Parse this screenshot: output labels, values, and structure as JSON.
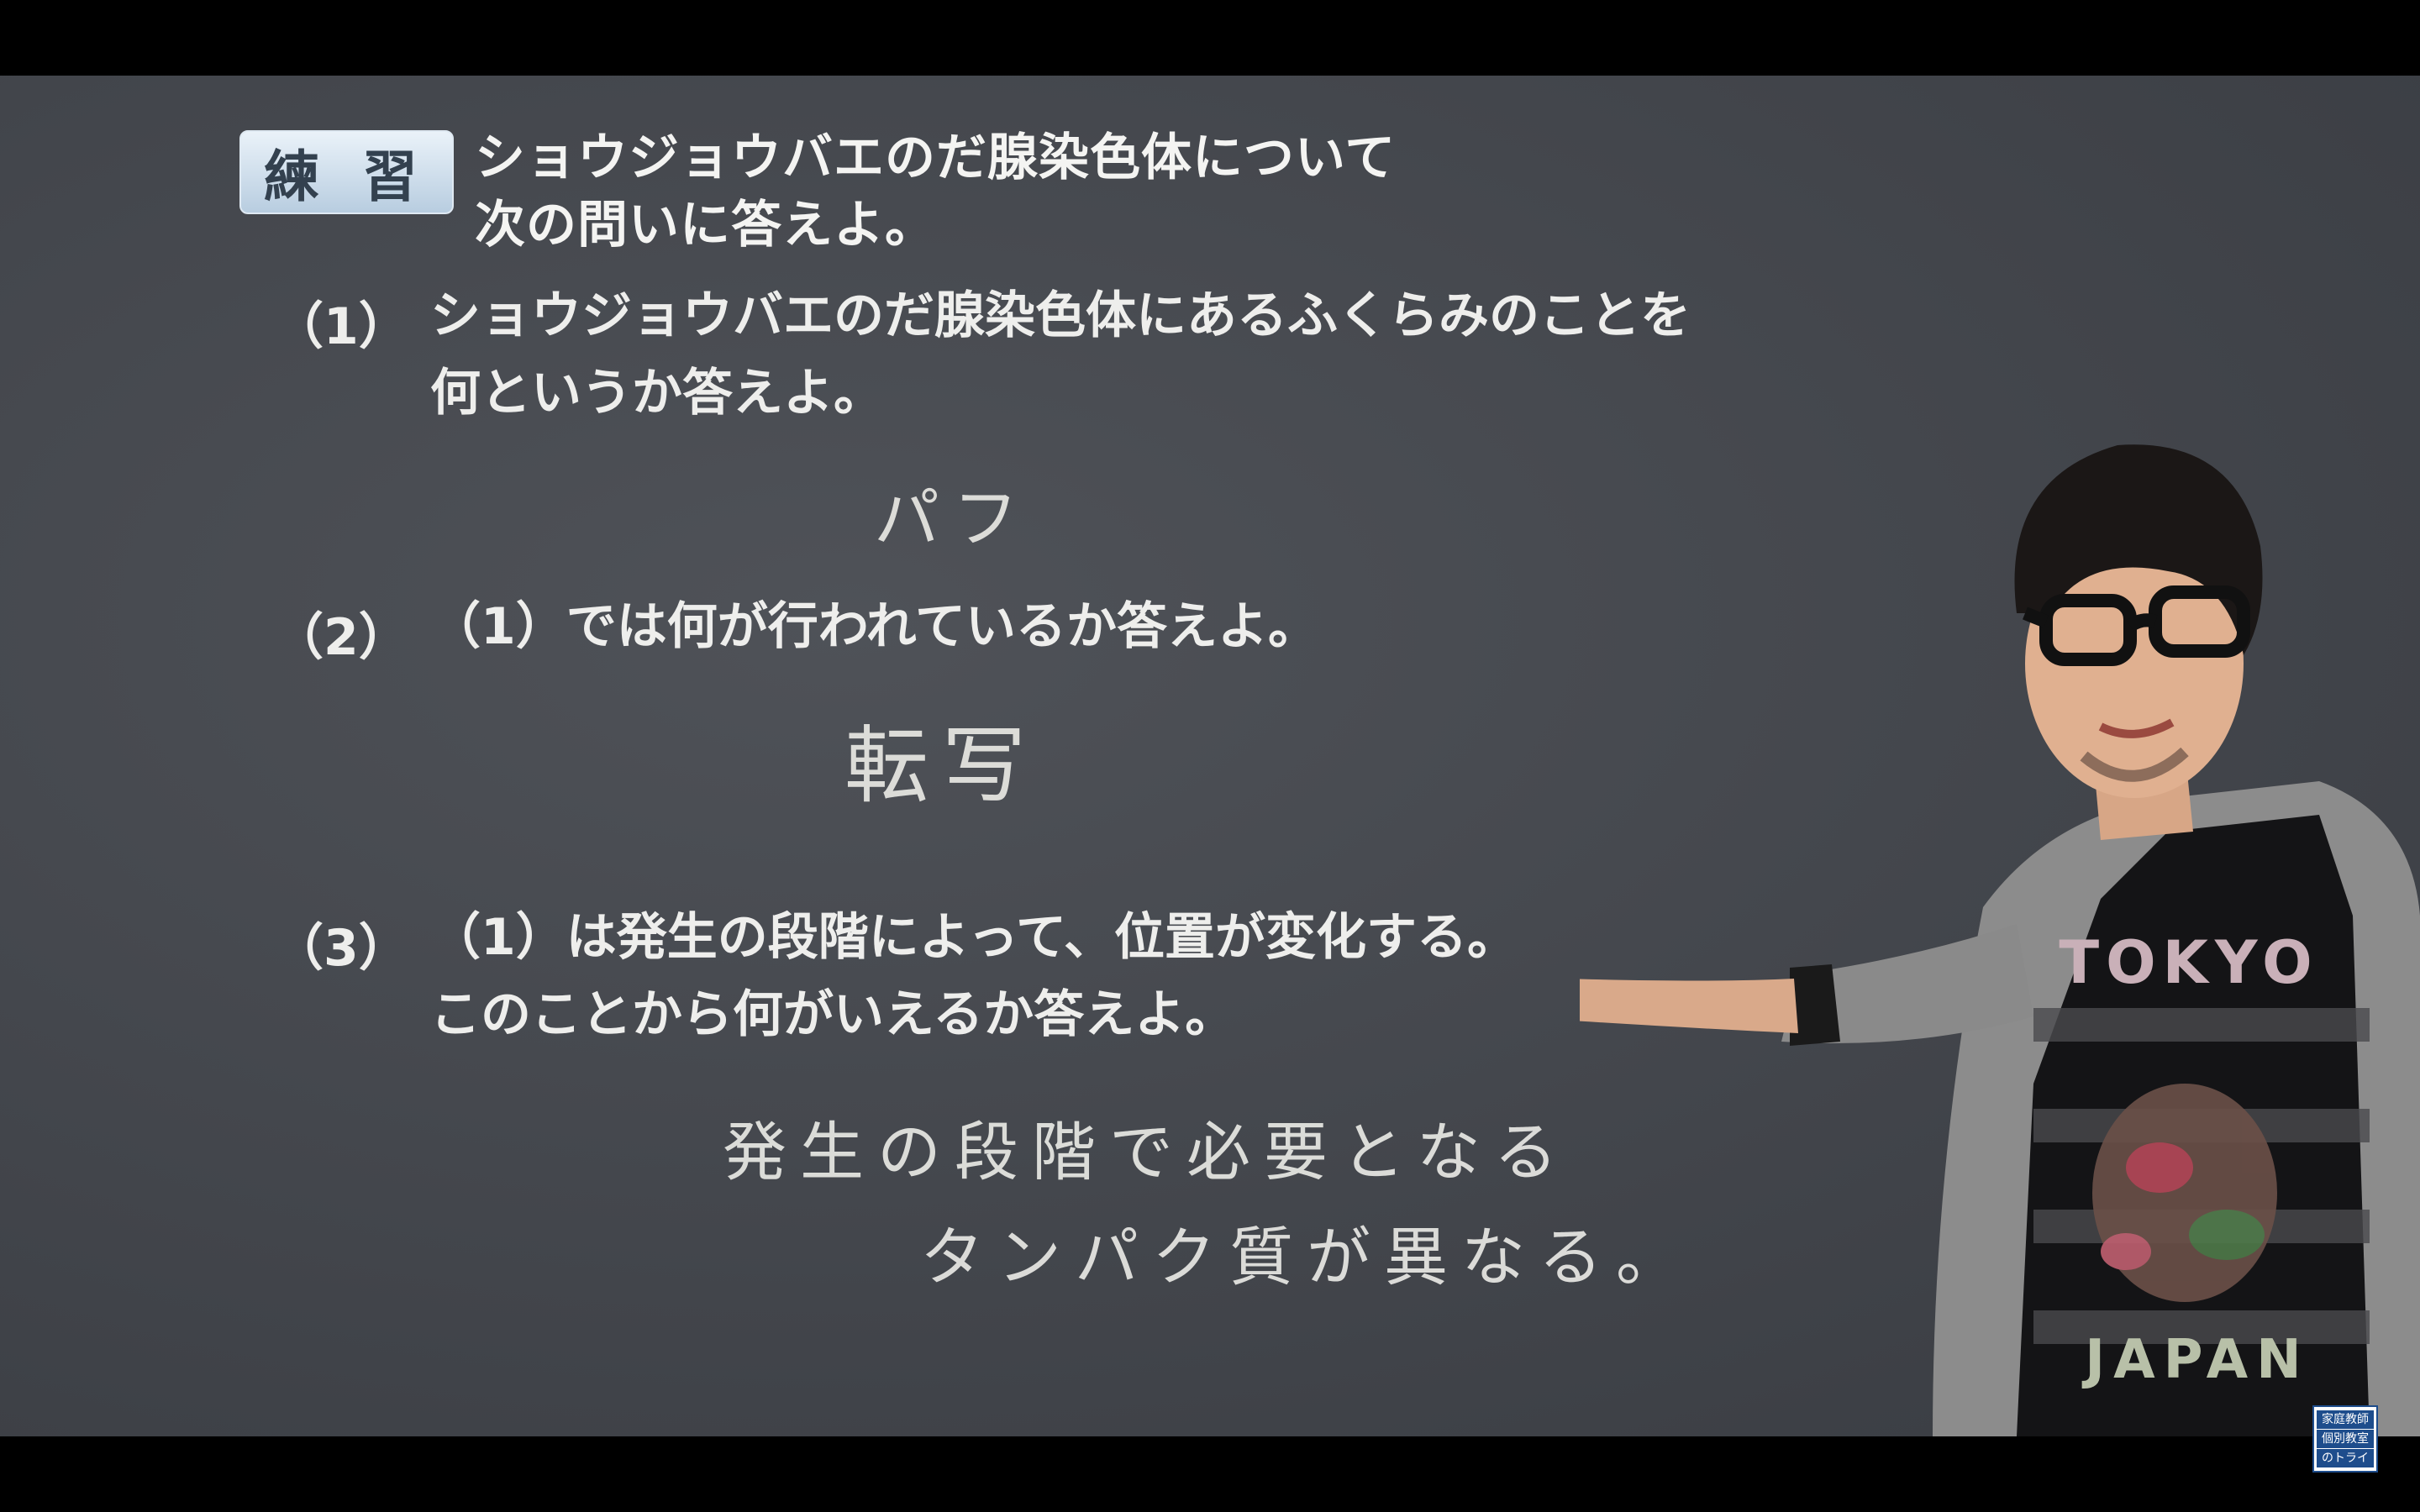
{
  "slide": {
    "badge": "練 習",
    "title_line1": "ショウジョウバエのだ腺染色体について",
    "title_line2": "次の問いに答えよ。",
    "questions": [
      {
        "number": "（1）",
        "line1": "ショウジョウバエのだ腺染色体にあるふくらみのことを",
        "line2": "何というか答えよ。",
        "answer_line1": "パフ",
        "answer_line2": ""
      },
      {
        "number": "（2）",
        "line1": "（1）では何が行われているか答えよ。",
        "line2": "",
        "answer_line1": "転写",
        "answer_line2": ""
      },
      {
        "number": "（3）",
        "line1": "（1）は発生の段階によって、位置が変化する。",
        "line2": "このことから何がいえるか答えよ。",
        "answer_line1": "発生の段階で必要となる",
        "answer_line2": "タンパク質が異なる。"
      }
    ]
  },
  "presenter": {
    "shirt_text_top": "TOKYO",
    "shirt_text_bottom": "JAPAN"
  },
  "logo": {
    "line1": "家庭教師",
    "line2": "個別教室",
    "line3": "のトライ"
  },
  "colors": {
    "board": "#45484e",
    "chalk": "#f4f4f2",
    "badge": "#cfdfee",
    "logo": "#1e4d8c"
  }
}
